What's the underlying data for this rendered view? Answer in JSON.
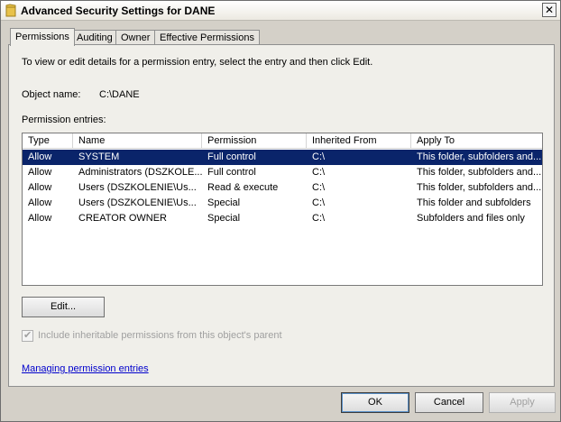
{
  "window": {
    "title": "Advanced Security Settings for DANE",
    "close_glyph": "✕"
  },
  "tabs": [
    {
      "label": "Permissions",
      "active": true
    },
    {
      "label": "Auditing",
      "active": false
    },
    {
      "label": "Owner",
      "active": false
    },
    {
      "label": "Effective Permissions",
      "active": false
    }
  ],
  "main": {
    "description": "To view or edit details for a permission entry, select the entry and then click Edit.",
    "object_name_label": "Object name:",
    "object_name_value": "C:\\DANE",
    "entries_label": "Permission entries:",
    "edit_button": "Edit...",
    "inherit_checkbox_label": "Include inheritable permissions from this object's parent",
    "inherit_checked": true,
    "link": "Managing permission entries"
  },
  "table": {
    "headers": [
      "Type",
      "Name",
      "Permission",
      "Inherited From",
      "Apply To"
    ],
    "rows": [
      [
        "Allow",
        "SYSTEM",
        "Full control",
        "C:\\",
        "This folder, subfolders and..."
      ],
      [
        "Allow",
        "Administrators (DSZKOLE...",
        "Full control",
        "C:\\",
        "This folder, subfolders and..."
      ],
      [
        "Allow",
        "Users (DSZKOLENIE\\Us...",
        "Read & execute",
        "C:\\",
        "This folder, subfolders and..."
      ],
      [
        "Allow",
        "Users (DSZKOLENIE\\Us...",
        "Special",
        "C:\\",
        "This folder and subfolders"
      ],
      [
        "Allow",
        "CREATOR OWNER",
        "Special",
        "C:\\",
        "Subfolders and files only"
      ]
    ],
    "selected_row": 0
  },
  "footer": {
    "ok": "OK",
    "cancel": "Cancel",
    "apply": "Apply"
  },
  "colors": {
    "selection": "#0a246a",
    "window_bg": "#d4d0c8",
    "link": "#0000cc"
  }
}
